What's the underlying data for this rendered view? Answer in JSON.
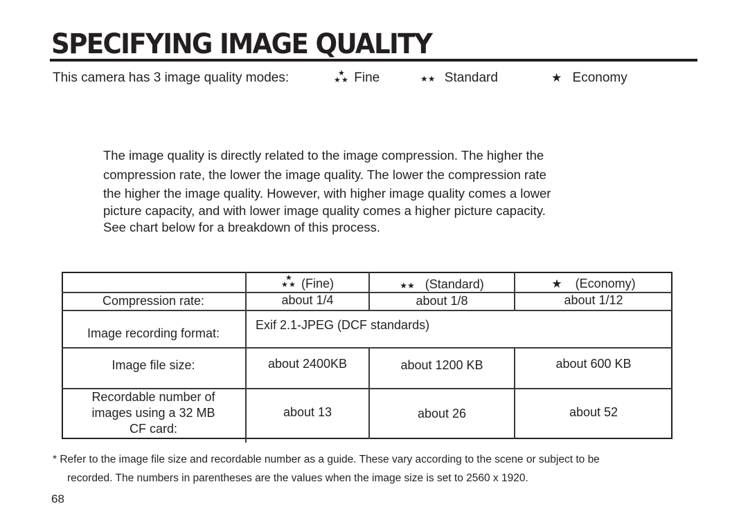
{
  "page": {
    "title": "SPECIFYING IMAGE QUALITY",
    "page_number": "68"
  },
  "modes": {
    "intro": "This camera has 3 image quality modes:",
    "items": [
      {
        "icon": "three-stars-icon",
        "label": "Fine",
        "stars": "★"
      },
      {
        "icon": "two-stars-icon",
        "label": "Standard",
        "stars": "★★"
      },
      {
        "icon": "one-star-icon",
        "label": "Economy",
        "stars": "★"
      }
    ]
  },
  "intro_paragraph": {
    "lines": [
      "The image quality is directly related to the image compression. The higher the",
      "compression rate, the lower the image quality. The lower the compression rate",
      "the higher the image quality. However, with higher image quality comes a lower",
      "picture capacity, and with lower image quality comes a higher picture capacity.",
      "See chart below for a breakdown of this process."
    ]
  },
  "table": {
    "headers": [
      "",
      "(Fine)",
      "(Standard)",
      "(Economy)"
    ],
    "rows": [
      {
        "label": "Compression rate:",
        "values": [
          "about 1/4",
          "about 1/8",
          "about 1/12"
        ]
      },
      {
        "label": "Image recording format:",
        "values": [
          "Exif 2.1-JPEG (DCF standards)"
        ]
      },
      {
        "label": "Image file size:",
        "values": [
          "about 2400KB",
          "about 1200 KB",
          "about 600 KB"
        ]
      },
      {
        "label_lines": [
          "Recordable number of",
          "images using a 32 MB",
          "CF card:"
        ],
        "values": [
          "about 13",
          "about 26",
          "about 52"
        ]
      }
    ]
  },
  "footnote": {
    "line1": "*  Refer to the image file size and recordable number as a guide. These vary according to the scene or subject to be",
    "line2": "recorded. The numbers in parentheses are the values when the image size is set to 2560 x 1920."
  },
  "colors": {
    "text": "#231f20",
    "rule": "#231f20",
    "background": "#ffffff"
  }
}
